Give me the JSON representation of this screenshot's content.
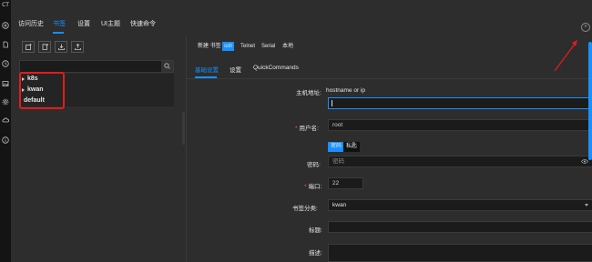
{
  "rail": {
    "logo": "CT",
    "icons": [
      "plus-circle-icon",
      "file-icon",
      "clock-icon",
      "image-icon",
      "gear-icon",
      "cloud-icon",
      "info-icon"
    ]
  },
  "topnav": {
    "tabs": [
      "访问历史",
      "书签",
      "设置",
      "UI主题",
      "快速命令"
    ],
    "active": "书签"
  },
  "bookmarks": {
    "toolbar_icons": [
      "new-folder-icon",
      "new-file-icon",
      "import-icon",
      "export-icon"
    ],
    "search_placeholder": "",
    "tree": [
      {
        "label": "k8s",
        "expandable": true
      },
      {
        "label": "kwan",
        "expandable": true
      },
      {
        "label": "default",
        "expandable": false
      }
    ]
  },
  "connection": {
    "type_label": "新建 书签",
    "types": [
      "ssh",
      "Telnet",
      "Serial",
      "本地"
    ],
    "active_type": "ssh",
    "subtabs": [
      "基础设置",
      "设置",
      "QuickCommands"
    ],
    "active_subtab": "基础设置"
  },
  "form": {
    "host": {
      "label": "主机地址:",
      "hint": "hostname or ip",
      "value": ""
    },
    "user": {
      "label": "用户名:",
      "value": "root"
    },
    "auth_tabs": [
      "密码",
      "私匙"
    ],
    "auth_active": "密码",
    "password": {
      "label": "密码:",
      "placeholder": "密码"
    },
    "port": {
      "label": "端口:",
      "value": "22"
    },
    "category": {
      "label": "书签分类:",
      "value": "kwan"
    },
    "title": {
      "label": "标题:",
      "value": ""
    },
    "description": {
      "label": "描述:",
      "value": ""
    }
  },
  "colors": {
    "accent": "#1890ff",
    "highlight": "#e31b1b",
    "background": "#2d2d2d"
  }
}
